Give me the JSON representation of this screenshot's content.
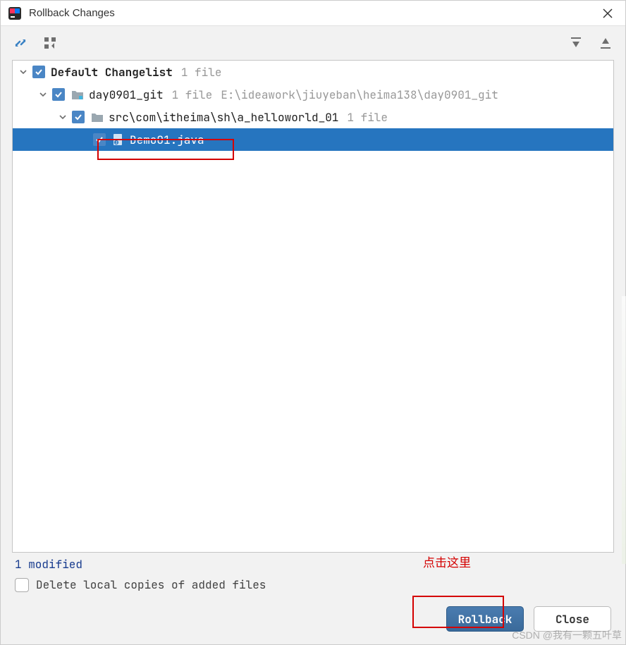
{
  "window": {
    "title": "Rollback Changes"
  },
  "tree": {
    "root": {
      "label": "Default Changelist",
      "meta": "1 file"
    },
    "level1": {
      "label": "day0901_git",
      "meta1": "1 file",
      "meta2": "E:\\ideawork\\jiuyeban\\heima138\\day0901_git"
    },
    "level2": {
      "label": "src\\com\\itheima\\sh\\a_helloworld_01",
      "meta": "1 file"
    },
    "file": {
      "label": "Demo01.java"
    }
  },
  "status": {
    "modified": "1 modified",
    "delete_label": "Delete local copies of added files"
  },
  "annotation": {
    "click_here": "点击这里"
  },
  "buttons": {
    "rollback": "Rollback",
    "close": "Close"
  },
  "watermark": "CSDN @我有一颗五叶草"
}
